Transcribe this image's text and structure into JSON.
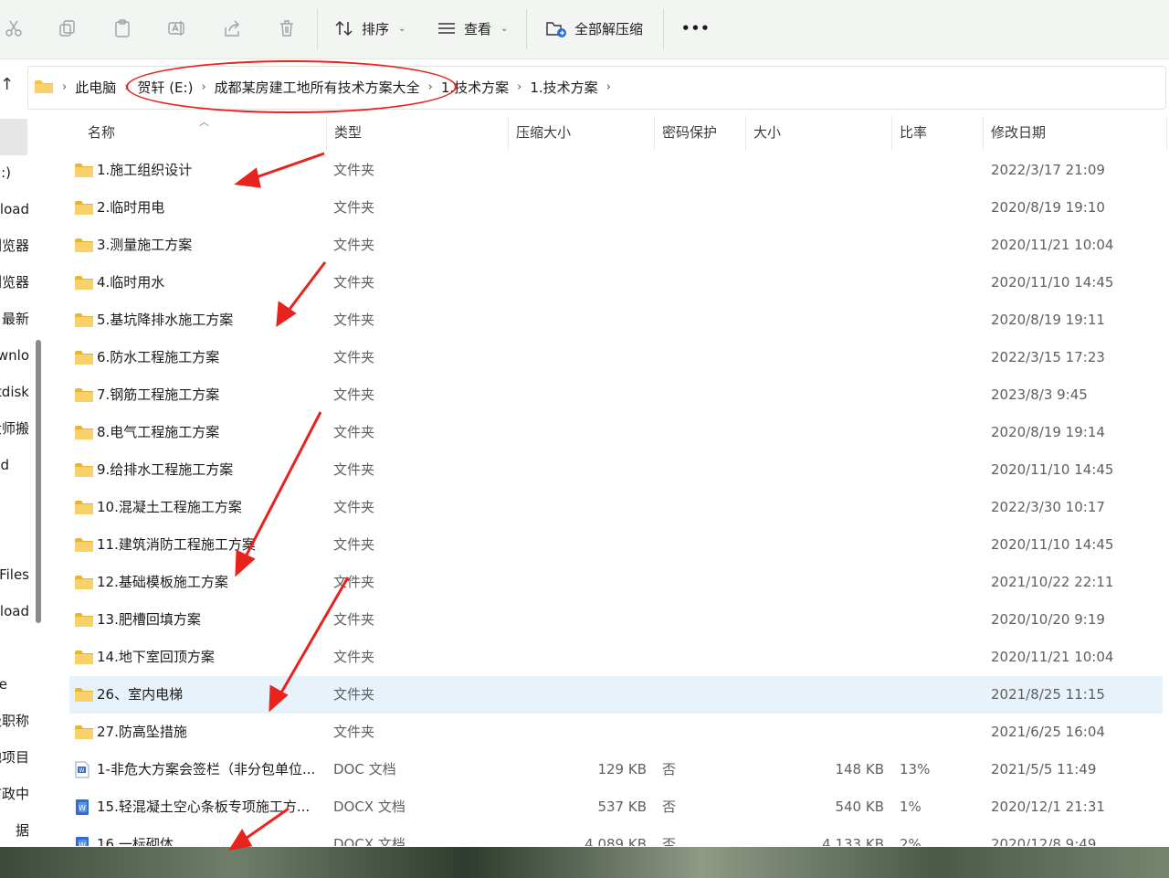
{
  "toolbar": {
    "sort_label": "排序",
    "view_label": "查看",
    "extract_label": "全部解压缩",
    "more_label": "•••"
  },
  "address": {
    "crumbs": [
      "此电脑",
      "贺轩 (E:)",
      "成都某房建工地所有技术方案大全",
      "1.技术方案",
      "1.技术方案"
    ]
  },
  "nav": {
    "items": [
      "G:)",
      "nload",
      "浏览器",
      "浏览器",
      "最新",
      "wnlo",
      "tdisk",
      "大师搬",
      "d",
      "Files",
      "nload",
      "e",
      "级职称",
      "地项目",
      "市政中",
      "据"
    ]
  },
  "columns": {
    "name": "名称",
    "type": "类型",
    "compressed": "压缩大小",
    "password": "密码保护",
    "size": "大小",
    "ratio": "比率",
    "modified": "修改日期"
  },
  "files": [
    {
      "name": "1.施工组织设计",
      "type": "文件夹",
      "compressed": "",
      "password": "",
      "size": "",
      "ratio": "",
      "date": "2022/3/17 21:09",
      "icon": "folder-icon"
    },
    {
      "name": "2.临时用电",
      "type": "文件夹",
      "compressed": "",
      "password": "",
      "size": "",
      "ratio": "",
      "date": "2020/8/19 19:10",
      "icon": "folder-icon"
    },
    {
      "name": "3.测量施工方案",
      "type": "文件夹",
      "compressed": "",
      "password": "",
      "size": "",
      "ratio": "",
      "date": "2020/11/21 10:04",
      "icon": "folder-icon"
    },
    {
      "name": "4.临时用水",
      "type": "文件夹",
      "compressed": "",
      "password": "",
      "size": "",
      "ratio": "",
      "date": "2020/11/10 14:45",
      "icon": "folder-icon"
    },
    {
      "name": "5.基坑降排水施工方案",
      "type": "文件夹",
      "compressed": "",
      "password": "",
      "size": "",
      "ratio": "",
      "date": "2020/8/19 19:11",
      "icon": "folder-icon"
    },
    {
      "name": "6.防水工程施工方案",
      "type": "文件夹",
      "compressed": "",
      "password": "",
      "size": "",
      "ratio": "",
      "date": "2022/3/15 17:23",
      "icon": "folder-icon"
    },
    {
      "name": "7.钢筋工程施工方案",
      "type": "文件夹",
      "compressed": "",
      "password": "",
      "size": "",
      "ratio": "",
      "date": "2023/8/3 9:45",
      "icon": "folder-icon"
    },
    {
      "name": "8.电气工程施工方案",
      "type": "文件夹",
      "compressed": "",
      "password": "",
      "size": "",
      "ratio": "",
      "date": "2020/8/19 19:14",
      "icon": "folder-icon"
    },
    {
      "name": "9.给排水工程施工方案",
      "type": "文件夹",
      "compressed": "",
      "password": "",
      "size": "",
      "ratio": "",
      "date": "2020/11/10 14:45",
      "icon": "folder-icon"
    },
    {
      "name": "10.混凝土工程施工方案",
      "type": "文件夹",
      "compressed": "",
      "password": "",
      "size": "",
      "ratio": "",
      "date": "2022/3/30 10:17",
      "icon": "folder-icon"
    },
    {
      "name": "11.建筑消防工程施工方案",
      "type": "文件夹",
      "compressed": "",
      "password": "",
      "size": "",
      "ratio": "",
      "date": "2020/11/10 14:45",
      "icon": "folder-icon"
    },
    {
      "name": "12.基础模板施工方案",
      "type": "文件夹",
      "compressed": "",
      "password": "",
      "size": "",
      "ratio": "",
      "date": "2021/10/22 22:11",
      "icon": "folder-icon"
    },
    {
      "name": "13.肥槽回填方案",
      "type": "文件夹",
      "compressed": "",
      "password": "",
      "size": "",
      "ratio": "",
      "date": "2020/10/20 9:19",
      "icon": "folder-icon"
    },
    {
      "name": "14.地下室回顶方案",
      "type": "文件夹",
      "compressed": "",
      "password": "",
      "size": "",
      "ratio": "",
      "date": "2020/11/21 10:04",
      "icon": "folder-icon"
    },
    {
      "name": "26、室内电梯",
      "type": "文件夹",
      "compressed": "",
      "password": "",
      "size": "",
      "ratio": "",
      "date": "2021/8/25 11:15",
      "icon": "folder-icon",
      "selected": true
    },
    {
      "name": "27.防高坠措施",
      "type": "文件夹",
      "compressed": "",
      "password": "",
      "size": "",
      "ratio": "",
      "date": "2021/6/25 16:04",
      "icon": "folder-icon"
    },
    {
      "name": "1-非危大方案会签栏（非分包单位...",
      "type": "DOC 文档",
      "compressed": "129 KB",
      "password": "否",
      "size": "148 KB",
      "ratio": "13%",
      "date": "2021/5/5 11:49",
      "icon": "doc-icon"
    },
    {
      "name": "15.轻混凝土空心条板专项施工方...",
      "type": "DOCX 文档",
      "compressed": "537 KB",
      "password": "否",
      "size": "540 KB",
      "ratio": "1%",
      "date": "2020/12/1 21:31",
      "icon": "docx-icon"
    },
    {
      "name": "16.一标砌体",
      "type": "DOCX 文档",
      "compressed": "4,089 KB",
      "password": "否",
      "size": "4,133 KB",
      "ratio": "2%",
      "date": "2020/12/8 9:49",
      "icon": "docx-icon"
    }
  ],
  "colors": {
    "annotation": "#e8231e",
    "folder": "#f4c341",
    "selection": "#e7f2fb",
    "word": "#2b6fd6"
  }
}
